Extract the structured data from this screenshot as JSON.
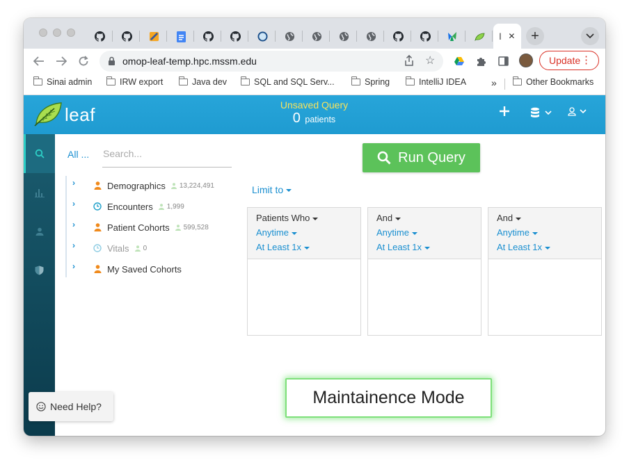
{
  "browser": {
    "url": "omop-leaf-temp.hpc.mssm.edu",
    "active_tab_title": "l",
    "active_tab_close": "✕",
    "new_tab_label": "+",
    "update_label": "Update",
    "tab_icons": [
      "github-icon",
      "github-icon",
      "orange-app-icon",
      "google-docs-icon",
      "github-icon",
      "github-icon",
      "circle-app-icon",
      "globe-icon",
      "globe-icon",
      "globe-icon",
      "globe-icon",
      "github-icon",
      "github-icon",
      "green-leaf-app-icon",
      "leaf-icon"
    ]
  },
  "bookmarks": {
    "items": [
      "Sinai admin",
      "IRW export",
      "Java dev",
      "SQL and SQL Serv...",
      "Spring",
      "IntelliJ IDEA"
    ],
    "overflow": "»",
    "other": "Other Bookmarks"
  },
  "header": {
    "logo": "leaf",
    "unsaved": "Unsaved Query",
    "patient_count": "0",
    "patients_label": "patients"
  },
  "concepts": {
    "all_label": "All ...",
    "search_placeholder": "Search...",
    "nodes": [
      {
        "label": "Demographics",
        "count": "13,224,491",
        "icon": "person-icon"
      },
      {
        "label": "Encounters",
        "count": "1,999",
        "icon": "clock-icon"
      },
      {
        "label": "Patient Cohorts",
        "count": "599,528",
        "icon": "person-icon"
      },
      {
        "label": "Vitals",
        "count": "0",
        "icon": "clock-icon"
      },
      {
        "label": "My Saved Cohorts",
        "count": "",
        "icon": "person-icon"
      }
    ]
  },
  "query": {
    "run_label": "Run Query",
    "limit_label": "Limit to",
    "panels": [
      {
        "head": "Patients Who",
        "time": "Anytime",
        "freq": "At Least 1x"
      },
      {
        "head": "And",
        "time": "Anytime",
        "freq": "At Least 1x"
      },
      {
        "head": "And",
        "time": "Anytime",
        "freq": "At Least 1x"
      }
    ]
  },
  "maintenance": "Maintainence Mode",
  "help": "Need Help?",
  "colors": {
    "header_blue": "#1f9bd1",
    "run_green": "#5cc25a",
    "link_blue": "#1a8fd0",
    "unsaved_yellow": "#f7e35c",
    "sidebar_teal": "#0b3b4c"
  }
}
